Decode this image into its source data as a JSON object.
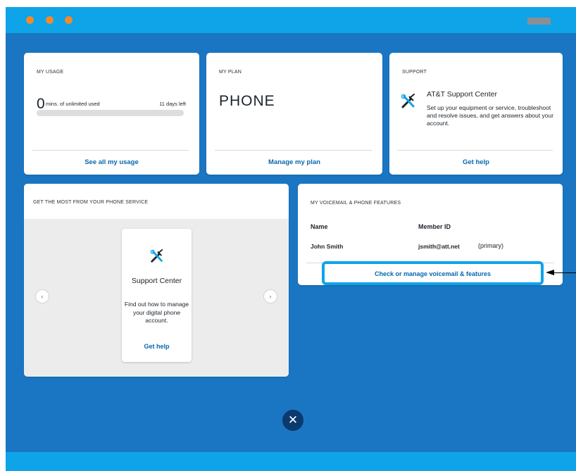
{
  "colors": {
    "window_bg": "#1a76c2",
    "titlebar": "#0fa3e8",
    "traffic_dot": "#f08a2c",
    "link": "#0568ae",
    "highlight": "#0fa3e8",
    "close_button": "#0a3a6e"
  },
  "usage": {
    "label": "MY USAGE",
    "amount": "0",
    "amount_text": "mins. of unlimited used",
    "days_left": "11 days left",
    "progress": 0,
    "link": "See all my usage"
  },
  "plan": {
    "label": "MY PLAN",
    "name": "PHONE",
    "link": "Manage my plan"
  },
  "support": {
    "label": "SUPPORT",
    "icon": "tools-icon",
    "title": "AT&T Support Center",
    "description": "Set up your equipment or service, troubleshoot and resolve issues, and get answers about your account.",
    "link": "Get help"
  },
  "promo": {
    "label": "GET THE MOST FROM YOUR PHONE SERVICE",
    "prev_icon": "‹",
    "next_icon": "›",
    "card": {
      "icon": "tools-icon",
      "title": "Support Center",
      "description": "Find out how to manage your digital phone account.",
      "link": "Get help"
    }
  },
  "voicemail": {
    "label": "MY VOICEMAIL & PHONE FEATURES",
    "columns": [
      "Name",
      "Member ID"
    ],
    "rows": [
      {
        "name": "John Smith",
        "member_id": "jsmith@att.net",
        "tag": "(primary)"
      }
    ],
    "link": "Check or manage voicemail & features"
  },
  "close_icon": "✕"
}
